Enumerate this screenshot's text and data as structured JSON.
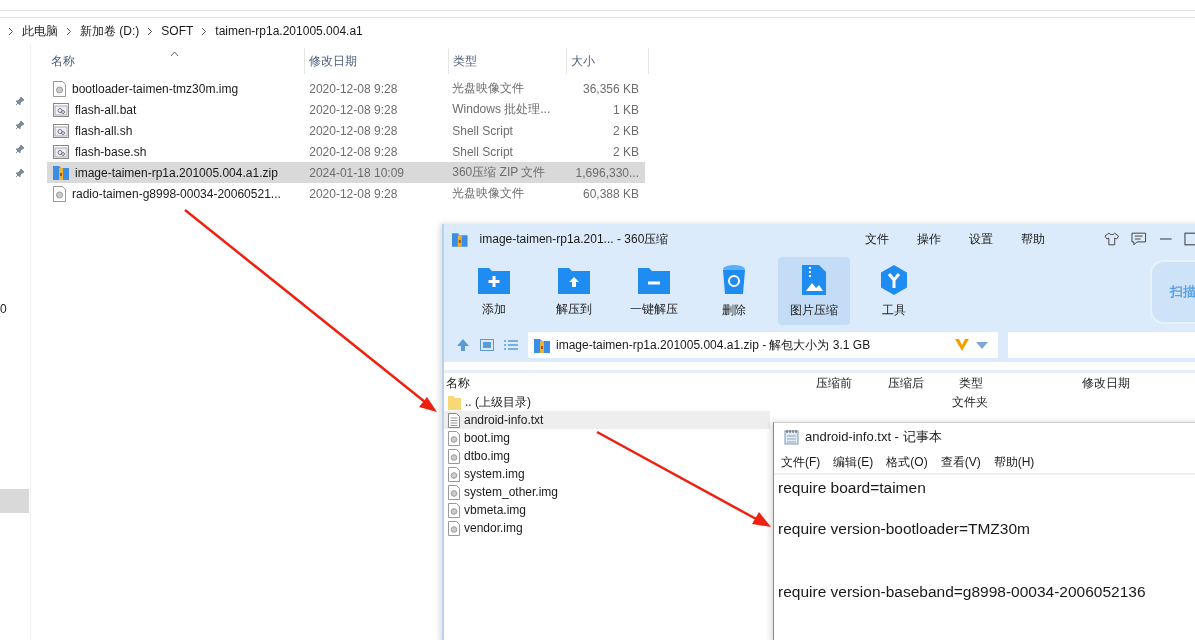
{
  "explorer": {
    "breadcrumb": [
      "此电脑",
      "新加卷 (D:)",
      "SOFT",
      "taimen-rp1a.201005.004.a1"
    ],
    "columns": [
      "名称",
      "修改日期",
      "类型",
      "大小"
    ],
    "files": [
      {
        "name": "bootloader-taimen-tmz30m.img",
        "date": "2020-12-08 9:28",
        "type": "光盘映像文件",
        "size": "36,356 KB",
        "kind": "disc",
        "selected": false
      },
      {
        "name": "flash-all.bat",
        "date": "2020-12-08 9:28",
        "type": "Windows 批处理...",
        "size": "1 KB",
        "kind": "script",
        "selected": false
      },
      {
        "name": "flash-all.sh",
        "date": "2020-12-08 9:28",
        "type": "Shell Script",
        "size": "2 KB",
        "kind": "script",
        "selected": false
      },
      {
        "name": "flash-base.sh",
        "date": "2020-12-08 9:28",
        "type": "Shell Script",
        "size": "2 KB",
        "kind": "script",
        "selected": false
      },
      {
        "name": "image-taimen-rp1a.201005.004.a1.zip",
        "date": "2024-01-18 10:09",
        "type": "360压缩 ZIP 文件",
        "size": "1,696,330...",
        "kind": "archive",
        "selected": true
      },
      {
        "name": "radio-taimen-g8998-00034-20060521...",
        "date": "2020-12-08 9:28",
        "type": "光盘映像文件",
        "size": "60,388 KB",
        "kind": "disc",
        "selected": false
      }
    ],
    "edge_text": "0"
  },
  "archive": {
    "title": "image-taimen-rp1a.201... - 360压缩",
    "menu": [
      "文件",
      "操作",
      "设置",
      "帮助"
    ],
    "tools": [
      {
        "label": "添加",
        "selected": false
      },
      {
        "label": "解压到",
        "selected": false
      },
      {
        "label": "一键解压",
        "selected": false
      },
      {
        "label": "删除",
        "selected": false
      },
      {
        "label": "图片压缩",
        "selected": true
      },
      {
        "label": "工具",
        "selected": false
      }
    ],
    "scan_label": "扫描",
    "path": "image-taimen-rp1a.201005.004.a1.zip - 解包大小为 3.1 GB",
    "columns": [
      "名称",
      "压缩前",
      "压缩后",
      "类型",
      "修改日期"
    ],
    "entries": [
      {
        "name": ".. (上级目录)",
        "kind": "folder",
        "type": "文件夹",
        "selected": false
      },
      {
        "name": "android-info.txt",
        "kind": "text",
        "selected": true
      },
      {
        "name": "boot.img",
        "kind": "disc",
        "selected": false
      },
      {
        "name": "dtbo.img",
        "kind": "disc",
        "selected": false
      },
      {
        "name": "system.img",
        "kind": "disc",
        "selected": false
      },
      {
        "name": "system_other.img",
        "kind": "disc",
        "selected": false
      },
      {
        "name": "vbmeta.img",
        "kind": "disc",
        "selected": false
      },
      {
        "name": "vendor.img",
        "kind": "disc",
        "selected": false
      }
    ]
  },
  "notepad": {
    "title": "android-info.txt - 记事本",
    "menu": [
      "文件(F)",
      "编辑(E)",
      "格式(O)",
      "查看(V)",
      "帮助(H)"
    ],
    "lines": [
      "require board=taimen",
      "require version-bootloader=TMZ30m",
      "require version-baseband=g8998-00034-2006052136"
    ]
  }
}
